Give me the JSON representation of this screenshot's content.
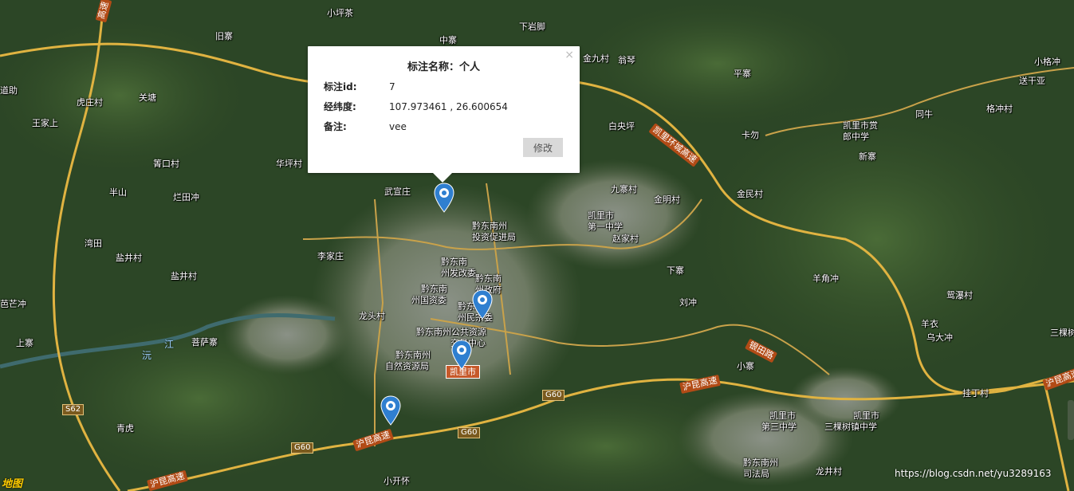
{
  "map": {
    "labels": {
      "xiaopingcha": "小坪茶",
      "xiayanjiao": "下岩脚",
      "zhongzhai": "中寨",
      "jiuzhai": "旧寨",
      "gaosu_top": "高速",
      "jinjiucun": "金九村",
      "wengqin": "翁琴",
      "pingzhai": "平寨",
      "xiaogecun": "小格冲",
      "songganya": "送干亚",
      "gechongcun": "格冲村",
      "tongniu": "同牛",
      "daozhi": "道助",
      "huzhuangcun": "虎庄村",
      "guantang": "关塘",
      "wangjia": "王家上",
      "kaili_xuan": "凯里市赏",
      "langzhong": "郎中学",
      "xinzhai": "新寨",
      "baiyangping": "白央坪",
      "kawu": "卡勿",
      "huapingcun": "华坪村",
      "pingkou": "箐口村",
      "banshan": "半山",
      "lantianchong": "烂田冲",
      "wuyizhuang": "武宣庄",
      "jiuzhai2": "九寨村",
      "jinmingcun": "金明村",
      "jinmincun": "金民村",
      "qiandong_tz1": "黔东南州",
      "qiandong_tz2": "投资促进局",
      "kaili_1zh1": "凯里市",
      "kaili_1zh2": "第一中学",
      "zhaojiacun": "赵家村",
      "wantian": "湾田",
      "yanjingcun": "盐井村",
      "lijiazhuang": "李家庄",
      "fgw1": "黔东南",
      "fgw2": "州发改委",
      "zf1": "黔东南",
      "zf2": "州政府",
      "gz1": "黔东南",
      "gz2": "州国资委",
      "mw1": "黔东南",
      "mw2": "州民宗委",
      "xiazhai": "下寨",
      "yangjiaochong": "羊角冲",
      "yuanpucun": "鸳瀑村",
      "yanjing2": "盐井村",
      "bamangchong": "芭芒冲",
      "longtoucun": "龙头村",
      "ggzy1": "黔东南州公共资源",
      "ggzy2": "交易中心",
      "liuchong": "刘冲",
      "yangyi": "羊衣",
      "wudachong": "乌大冲",
      "sanjiecun": "三棵树",
      "shangzhai": "上寨",
      "pusazhai": "菩萨寨",
      "zr1": "黔东南州",
      "zr2": "自然资源局",
      "xiaozhai": "小寨",
      "guidingcun": "挂丁村",
      "qinghu": "青虎",
      "kaili_3zh1": "凯里市",
      "kaili_3zh2": "第三中学",
      "kaili_sks1": "凯里市",
      "kaili_sks2": "三棵树镇中学",
      "fy1": "黔东南州",
      "fy2": "司法局",
      "longjingcun": "龙井村",
      "xiaokaihuai": "小开怀"
    },
    "roads": {
      "huanchengshaosu": "凯里环城高速",
      "huluogaosu1": "沪昆高速",
      "huluogaosu2": "沪昆高速",
      "huluogaosu3": "沪昆高速",
      "huluogaosu4": "沪昆高速",
      "yintianlu": "银田路",
      "g60a": "G60",
      "g60b": "G60",
      "g60c": "G60",
      "s62": "S62"
    },
    "rivers": {
      "r1": "沅",
      "r2": "江"
    },
    "city_label": "凯里市",
    "logo": "地图",
    "watermark": "https://blog.csdn.net/yu3289163"
  },
  "popup": {
    "title": "标注名称：个人",
    "close": "×",
    "id_label": "标注id:",
    "id_value": "7",
    "coord_label": "经纬度:",
    "coord_value": "107.973461 , 26.600654",
    "note_label": "备注:",
    "note_value": "vee",
    "edit_button": "修改"
  },
  "markers": [
    {
      "name": "marker-1",
      "color": "#2f7fd0"
    },
    {
      "name": "marker-2",
      "color": "#2f7fd0"
    },
    {
      "name": "marker-3",
      "color": "#2f7fd0"
    },
    {
      "name": "marker-4",
      "color": "#2f7fd0"
    }
  ],
  "colors": {
    "highway": "#e0b341",
    "road": "#c9a24a",
    "forest": "#2e4a26",
    "popup_bg": "#ffffff",
    "marker": "#2f7fd0"
  }
}
